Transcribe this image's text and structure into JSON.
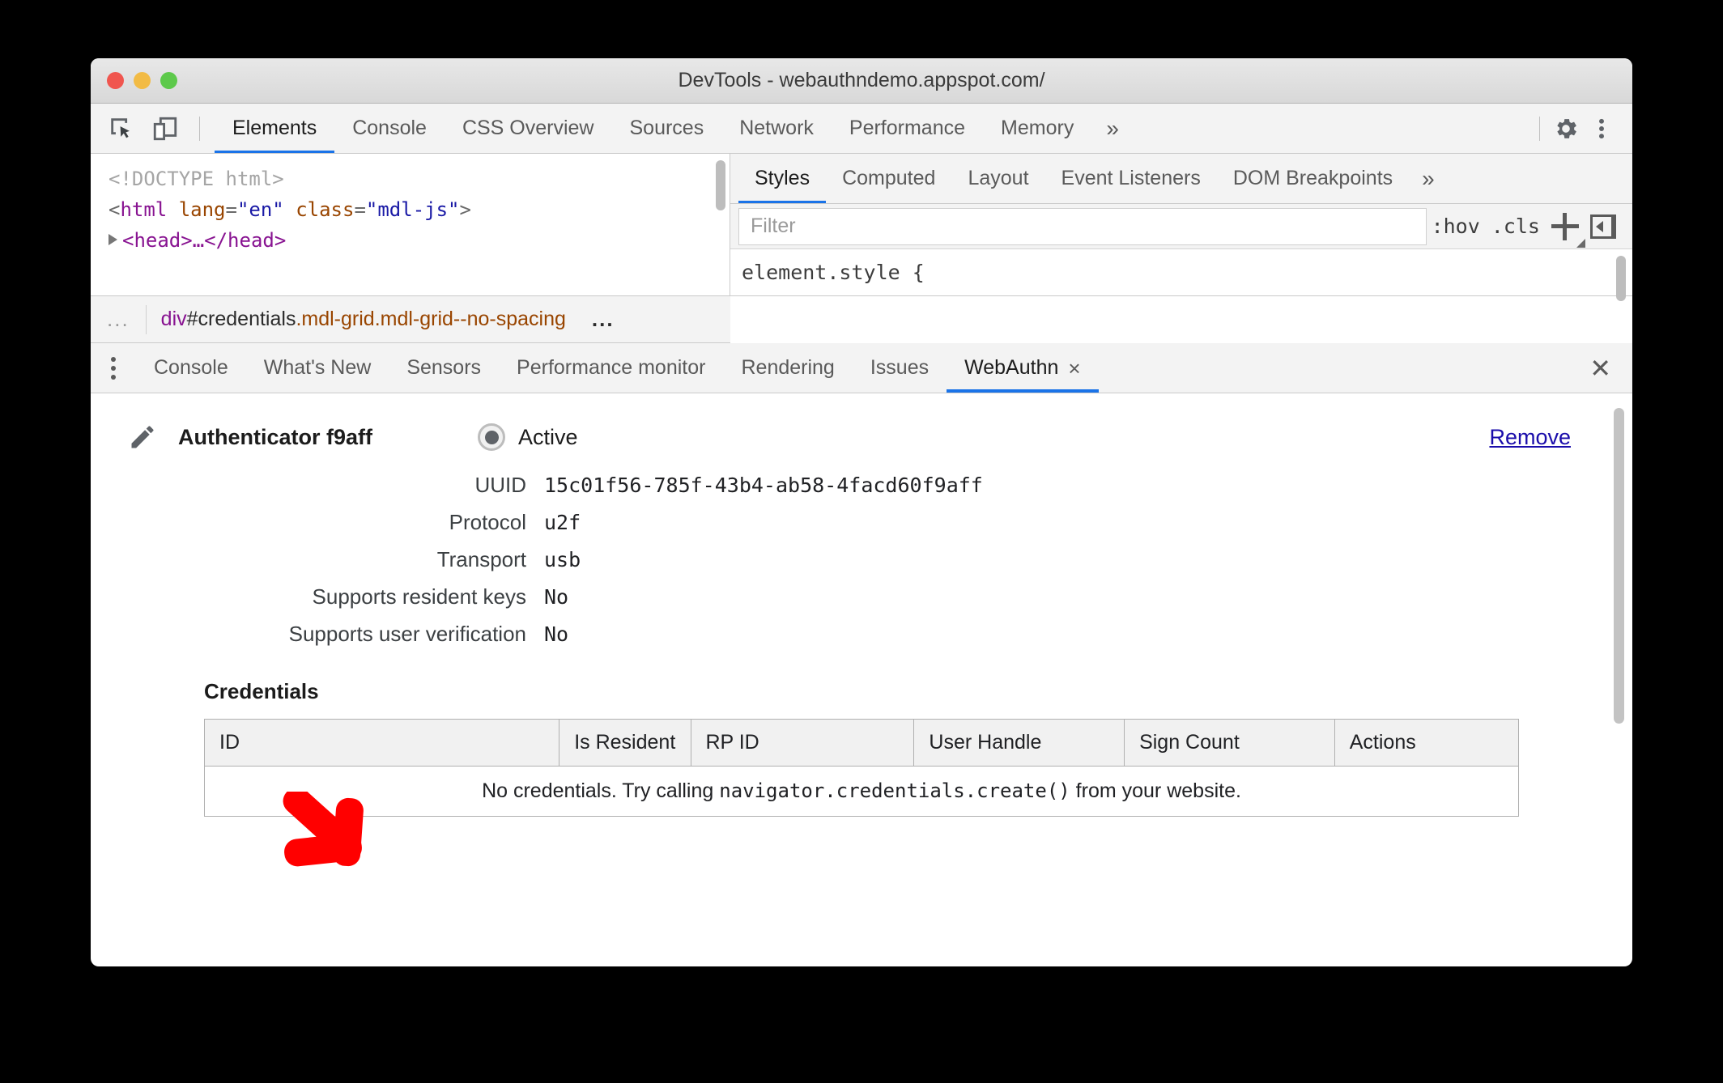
{
  "window": {
    "title": "DevTools - webauthndemo.appspot.com/",
    "traffic_lights": [
      "close",
      "minimize",
      "zoom"
    ]
  },
  "toolbar": {
    "icons": [
      {
        "name": "inspect-element-icon",
        "label": "Inspect element"
      },
      {
        "name": "device-toolbar-icon",
        "label": "Toggle device toolbar"
      }
    ],
    "tabs": [
      {
        "label": "Elements",
        "active": true
      },
      {
        "label": "Console",
        "active": false
      },
      {
        "label": "CSS Overview",
        "active": false
      },
      {
        "label": "Sources",
        "active": false
      },
      {
        "label": "Network",
        "active": false
      },
      {
        "label": "Performance",
        "active": false
      },
      {
        "label": "Memory",
        "active": false
      }
    ],
    "more_label": "»",
    "settings_icon": "gear-icon",
    "menu_icon": "kebab-menu-icon"
  },
  "elements_panel": {
    "dom_lines": [
      {
        "type": "doctype",
        "text": "<!DOCTYPE html>"
      },
      {
        "type": "tag",
        "open": "<",
        "tag": "html",
        "attrs": [
          {
            "name": "lang",
            "value": "\"en\""
          },
          {
            "name": "class",
            "value": "\"mdl-js\""
          }
        ],
        "close": ">"
      },
      {
        "type": "collapsed",
        "text": "<head>…</head>"
      }
    ],
    "breadcrumb": {
      "leading_ellipsis": "...",
      "tag": "div",
      "id": "#credentials",
      "classes": ".mdl-grid.mdl-grid--no-spacing",
      "trailing_ellipsis": "..."
    }
  },
  "styles_panel": {
    "tabs": [
      {
        "label": "Styles",
        "active": true
      },
      {
        "label": "Computed",
        "active": false
      },
      {
        "label": "Layout",
        "active": false
      },
      {
        "label": "Event Listeners",
        "active": false
      },
      {
        "label": "DOM Breakpoints",
        "active": false
      }
    ],
    "more_label": "»",
    "filter_placeholder": "Filter",
    "filter_value": "",
    "hov_label": ":hov",
    "cls_label": ".cls",
    "new_rule_icon": "plus-icon",
    "toggle_sidebar_icon": "toggle-sidebar-icon",
    "rule_header": "element.style {"
  },
  "drawer": {
    "menu_icon": "kebab-menu-icon",
    "tabs": [
      {
        "label": "Console",
        "active": false,
        "closable": false
      },
      {
        "label": "What's New",
        "active": false,
        "closable": false
      },
      {
        "label": "Sensors",
        "active": false,
        "closable": false
      },
      {
        "label": "Performance monitor",
        "active": false,
        "closable": false
      },
      {
        "label": "Rendering",
        "active": false,
        "closable": false
      },
      {
        "label": "Issues",
        "active": false,
        "closable": false
      },
      {
        "label": "WebAuthn",
        "active": true,
        "closable": true,
        "close_glyph": "×"
      }
    ],
    "close_drawer_glyph": "✕"
  },
  "webauthn": {
    "edit_icon": "pencil-icon",
    "authenticator_title": "Authenticator f9aff",
    "active_label": "Active",
    "active_selected": true,
    "remove_label": "Remove",
    "details": [
      {
        "label": "UUID",
        "value": "15c01f56-785f-43b4-ab58-4facd60f9aff"
      },
      {
        "label": "Protocol",
        "value": "u2f"
      },
      {
        "label": "Transport",
        "value": "usb"
      },
      {
        "label": "Supports resident keys",
        "value": "No"
      },
      {
        "label": "Supports user verification",
        "value": "No"
      }
    ],
    "credentials": {
      "heading": "Credentials",
      "columns": [
        "ID",
        "Is Resident",
        "RP ID",
        "User Handle",
        "Sign Count",
        "Actions"
      ],
      "rows": [],
      "empty_message_prefix": "No credentials. Try calling ",
      "empty_message_code": "navigator.credentials.create()",
      "empty_message_suffix": " from your website."
    }
  },
  "annotation": {
    "arrow": {
      "name": "red-annotation-arrow",
      "color": "#FF0000",
      "direction": "down-right"
    }
  }
}
